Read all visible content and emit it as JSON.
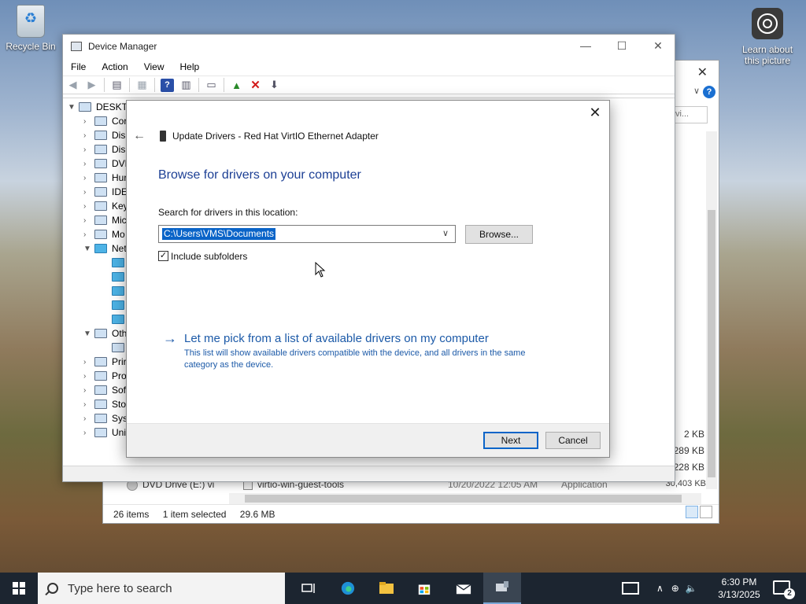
{
  "desktop": {
    "recycle_bin_label": "Recycle Bin",
    "learn_label_line1": "Learn about",
    "learn_label_line2": "this picture"
  },
  "explorer": {
    "search_placeholder": "vi...",
    "row_dvd_drive": "DVD Drive (E:) vi",
    "row_file_name": "virtio-win-guest-tools",
    "row_file_date": "10/20/2022 12:05 AM",
    "row_file_type": "Application",
    "row_file_size": "30,403 KB",
    "sizes": [
      "2 KB",
      "5,289 KB",
      "5,228 KB"
    ],
    "status_items": "26 items",
    "status_selected": "1 item selected",
    "status_size": "29.6 MB"
  },
  "devmgr": {
    "title": "Device Manager",
    "menu": [
      "File",
      "Action",
      "View",
      "Help"
    ],
    "tree": {
      "root": "DESKTO",
      "items": [
        "Cor",
        "Disl",
        "Disp",
        "DVD",
        "Hur",
        "IDE",
        "Key",
        "Mic",
        "Mo",
        "Net",
        "Oth",
        "Prir",
        "Pro",
        "Sof",
        "Sto",
        "Syst",
        "Uni"
      ]
    }
  },
  "dialog": {
    "title": "Update Drivers - Red Hat VirtIO Ethernet Adapter",
    "heading": "Browse for drivers on your computer",
    "search_label": "Search for drivers in this location:",
    "path_value": "C:\\Users\\VMS\\Documents",
    "browse_label": "Browse...",
    "include_subfolders_label": "Include subfolders",
    "include_subfolders_checked": true,
    "pick_link": "Let me pick from a list of available drivers on my computer",
    "pick_desc": "This list will show available drivers compatible with the device, and all drivers in the same category as the device.",
    "next_label": "Next",
    "cancel_label": "Cancel"
  },
  "taskbar": {
    "search_placeholder": "Type here to search",
    "clock_time": "6:30 PM",
    "clock_date": "3/13/2025",
    "notification_count": "2"
  }
}
